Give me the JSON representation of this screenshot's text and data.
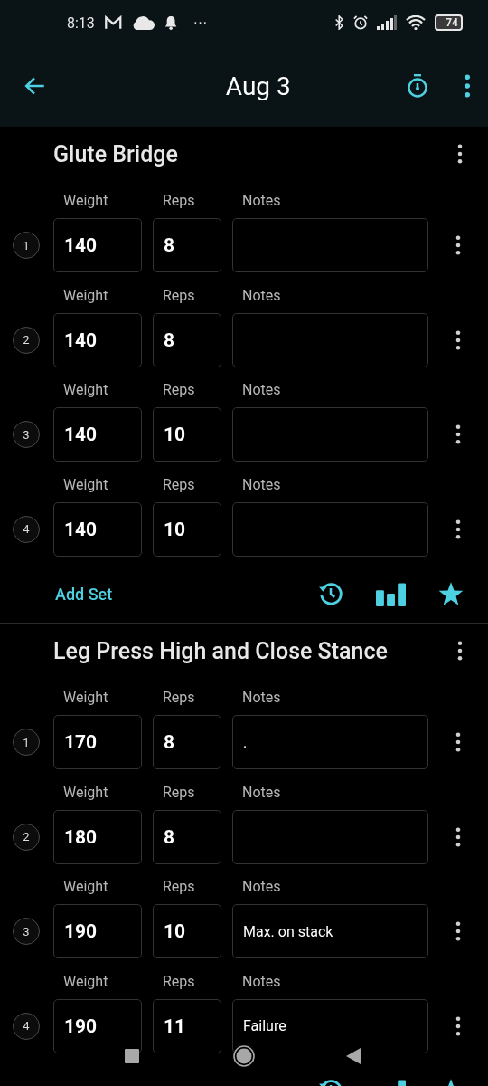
{
  "status_bar": {
    "time": "8:13",
    "more": "···",
    "battery": "74"
  },
  "app_bar": {
    "title": "Aug 3"
  },
  "exercises": [
    {
      "name": "Glute Bridge",
      "add_set": "Add Set",
      "sets": [
        {
          "number": "1",
          "weight_label": "Weight",
          "weight": "140",
          "reps_label": "Reps",
          "reps": "8",
          "notes_label": "Notes"
        },
        {
          "number": "2",
          "weight_label": "Weight",
          "weight": "140",
          "reps_label": "Reps",
          "reps": "8",
          "notes_label": "Notes"
        },
        {
          "number": "3",
          "weight_label": "Weight",
          "weight": "140",
          "reps_label": "Reps",
          "reps": "10",
          "notes_label": "Notes"
        },
        {
          "number": "4",
          "weight_label": "Weight",
          "weight": "140",
          "reps_label": "Reps",
          "reps": "10",
          "notes_label": "Notes"
        }
      ]
    },
    {
      "name": "Leg Press High and Close Stance",
      "sets": [
        {
          "number": "1",
          "weight_label": "Weight",
          "weight": "170",
          "reps_label": "Reps",
          "reps": "8",
          "notes_label": "Notes",
          "notes": "."
        },
        {
          "number": "2",
          "weight_label": "Weight",
          "weight": "180",
          "reps_label": "Reps",
          "reps": "8",
          "notes_label": "Notes"
        },
        {
          "number": "3",
          "weight_label": "Weight",
          "weight": "190",
          "reps_label": "Reps",
          "reps": "10",
          "notes_label": "Notes",
          "notes": "Max. on stack"
        },
        {
          "number": "4",
          "weight_label": "Weight",
          "weight": "190",
          "reps_label": "Reps",
          "reps": "11",
          "notes_label": "Notes",
          "notes": "Failure"
        }
      ]
    }
  ]
}
